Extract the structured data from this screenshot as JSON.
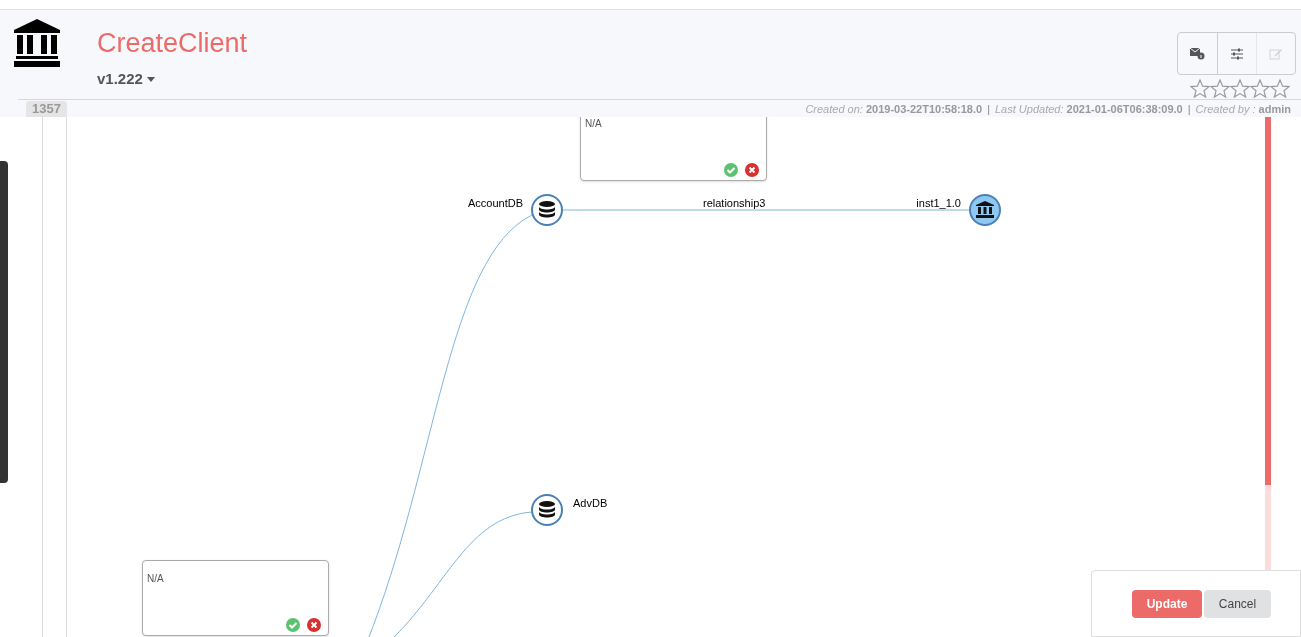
{
  "header": {
    "title": "CreateClient",
    "version": "v1.222",
    "id_badge": "1357"
  },
  "toolbar": [
    {
      "kind": "mail-info",
      "disabled": false
    },
    {
      "kind": "sliders",
      "disabled": false
    },
    {
      "kind": "edit",
      "disabled": true
    }
  ],
  "rating": {
    "stars": 0
  },
  "meta": {
    "separator": "|",
    "items": [
      {
        "label": "Created on:",
        "value": "2019-03-22T10:58:18.0"
      },
      {
        "label": "Last Updated:",
        "value": "2021-01-06T06:38:09.0"
      },
      {
        "label": "Created by :",
        "value": "admin"
      }
    ]
  },
  "diagram": {
    "nodes": [
      {
        "label": "AccountDB",
        "kind": "database",
        "selected": false
      },
      {
        "label": "inst1_1.0",
        "kind": "institution",
        "selected": true
      },
      {
        "label": "AdvDB",
        "kind": "database",
        "selected": false
      }
    ],
    "edges": [
      {
        "label": "relationship3"
      }
    ],
    "notes": [
      {
        "text": "N/A"
      },
      {
        "text": "N/A"
      }
    ]
  },
  "actions": [
    {
      "label": "Update",
      "kind": "primary"
    },
    {
      "label": "Cancel",
      "kind": "secondary"
    }
  ]
}
